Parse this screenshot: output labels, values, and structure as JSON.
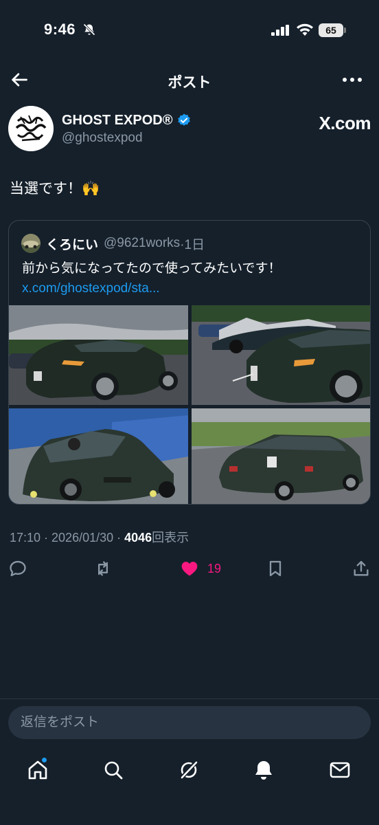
{
  "status_bar": {
    "time": "9:46",
    "battery": "65"
  },
  "header": {
    "title": "ポスト"
  },
  "author": {
    "name": "GHOST EXPOD®",
    "handle": "@ghostexpod",
    "brand": "X.com"
  },
  "tweet": {
    "text": "当選です！🙌"
  },
  "quote": {
    "name": "くろにい",
    "handle": "@9621works",
    "time": "·1日",
    "text": "前から気になってたので使ってみたいです！",
    "link": "x.com/ghostexpod/sta..."
  },
  "meta": {
    "timestamp": "17:10 · 2026/01/30 · ",
    "views": "4046",
    "views_label": "回表示"
  },
  "actions": {
    "like_count": "19"
  },
  "reply": {
    "placeholder": "返信をポスト"
  },
  "colors": {
    "background": "#15202b",
    "accent": "#1d9bf0",
    "like": "#f91880",
    "muted": "#8b98a5"
  },
  "icons": [
    "bell-off-icon",
    "signal-icon",
    "wifi-icon",
    "back-arrow-icon",
    "more-icon",
    "verified-icon",
    "reply-icon",
    "retweet-icon",
    "heart-icon",
    "bookmark-icon",
    "share-icon",
    "home-icon",
    "search-icon",
    "grok-icon",
    "notifications-icon",
    "messages-icon"
  ]
}
